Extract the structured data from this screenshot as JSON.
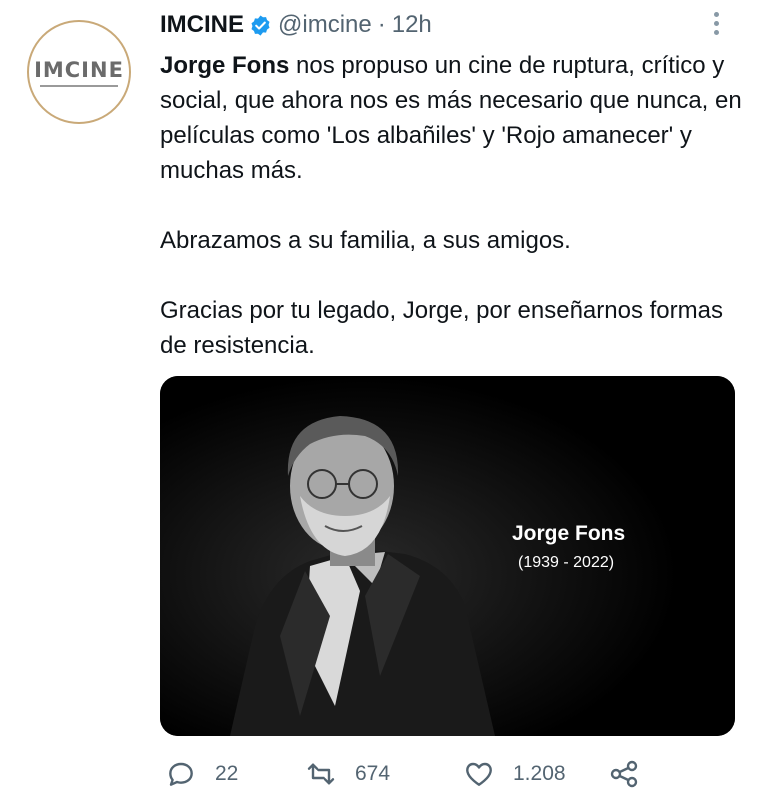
{
  "account": {
    "name": "IMCINE",
    "handle": "@imcine",
    "separator": "·",
    "time": "12h",
    "avatar_text": "IMCINE"
  },
  "tweet": {
    "lead_bold": "Jorge Fons",
    "text_after_bold": " nos propuso un cine de ruptura, crítico y social, que ahora nos es más necesario que nunca, en películas como 'Los albañiles' y 'Rojo amanecer' y muchas más.\n\nAbrazamos a su familia, a sus amigos.\n\nGracias por tu legado, Jorge, por enseñarnos formas de resistencia."
  },
  "media": {
    "title": "Jorge Fons",
    "dates": "(1939 - 2022)"
  },
  "actions": {
    "replies": "22",
    "retweets": "674",
    "likes": "1.208"
  },
  "colors": {
    "text": "#0f1419",
    "muted": "#536471",
    "verified": "#1d9bf0",
    "avatar_ring": "#c9a978"
  }
}
